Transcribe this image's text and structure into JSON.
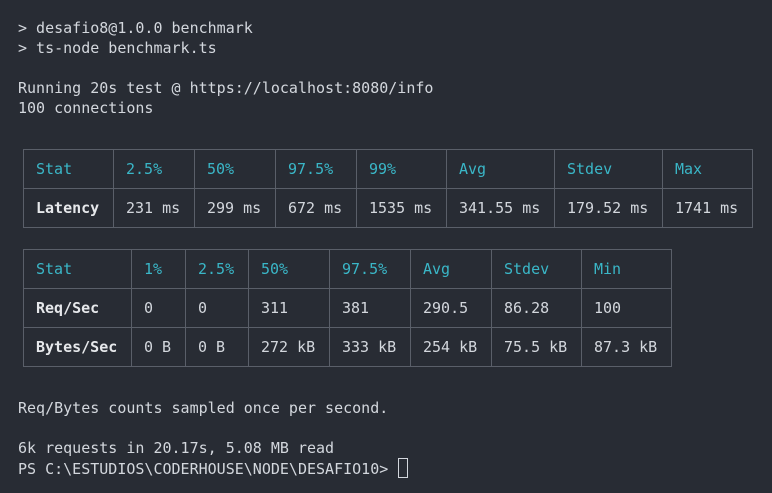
{
  "terminal": {
    "lines": {
      "l1": "> desafio8@1.0.0 benchmark",
      "l2": "> ts-node benchmark.ts",
      "l3": "Running 20s test @ https://localhost:8080/info",
      "l4": "100 connections",
      "l5": "Req/Bytes counts sampled once per second.",
      "l6": "6k requests in 20.17s, 5.08 MB read",
      "prompt": "PS C:\\ESTUDIOS\\CODERHOUSE\\NODE\\DESAFIO10> "
    }
  },
  "latency_table": {
    "header": [
      "Stat",
      "2.5%",
      "50%",
      "97.5%",
      "99%",
      "Avg",
      "Stdev",
      "Max"
    ],
    "rows": [
      [
        "Latency",
        "231 ms",
        "299 ms",
        "672 ms",
        "1535 ms",
        "341.55 ms",
        "179.52 ms",
        "1741 ms"
      ]
    ]
  },
  "throughput_table": {
    "header": [
      "Stat",
      "1%",
      "2.5%",
      "50%",
      "97.5%",
      "Avg",
      "Stdev",
      "Min"
    ],
    "rows": [
      [
        "Req/Sec",
        "0",
        "0",
        "311",
        "381",
        "290.5",
        "86.28",
        "100"
      ],
      [
        "Bytes/Sec",
        "0 B",
        "0 B",
        "272 kB",
        "333 kB",
        "254 kB",
        "75.5 kB",
        "87.3 kB"
      ]
    ]
  },
  "colors": {
    "background": "#282c34",
    "text": "#d3d7dd",
    "header_accent": "#3ab7c8",
    "border": "#5a5f69"
  }
}
